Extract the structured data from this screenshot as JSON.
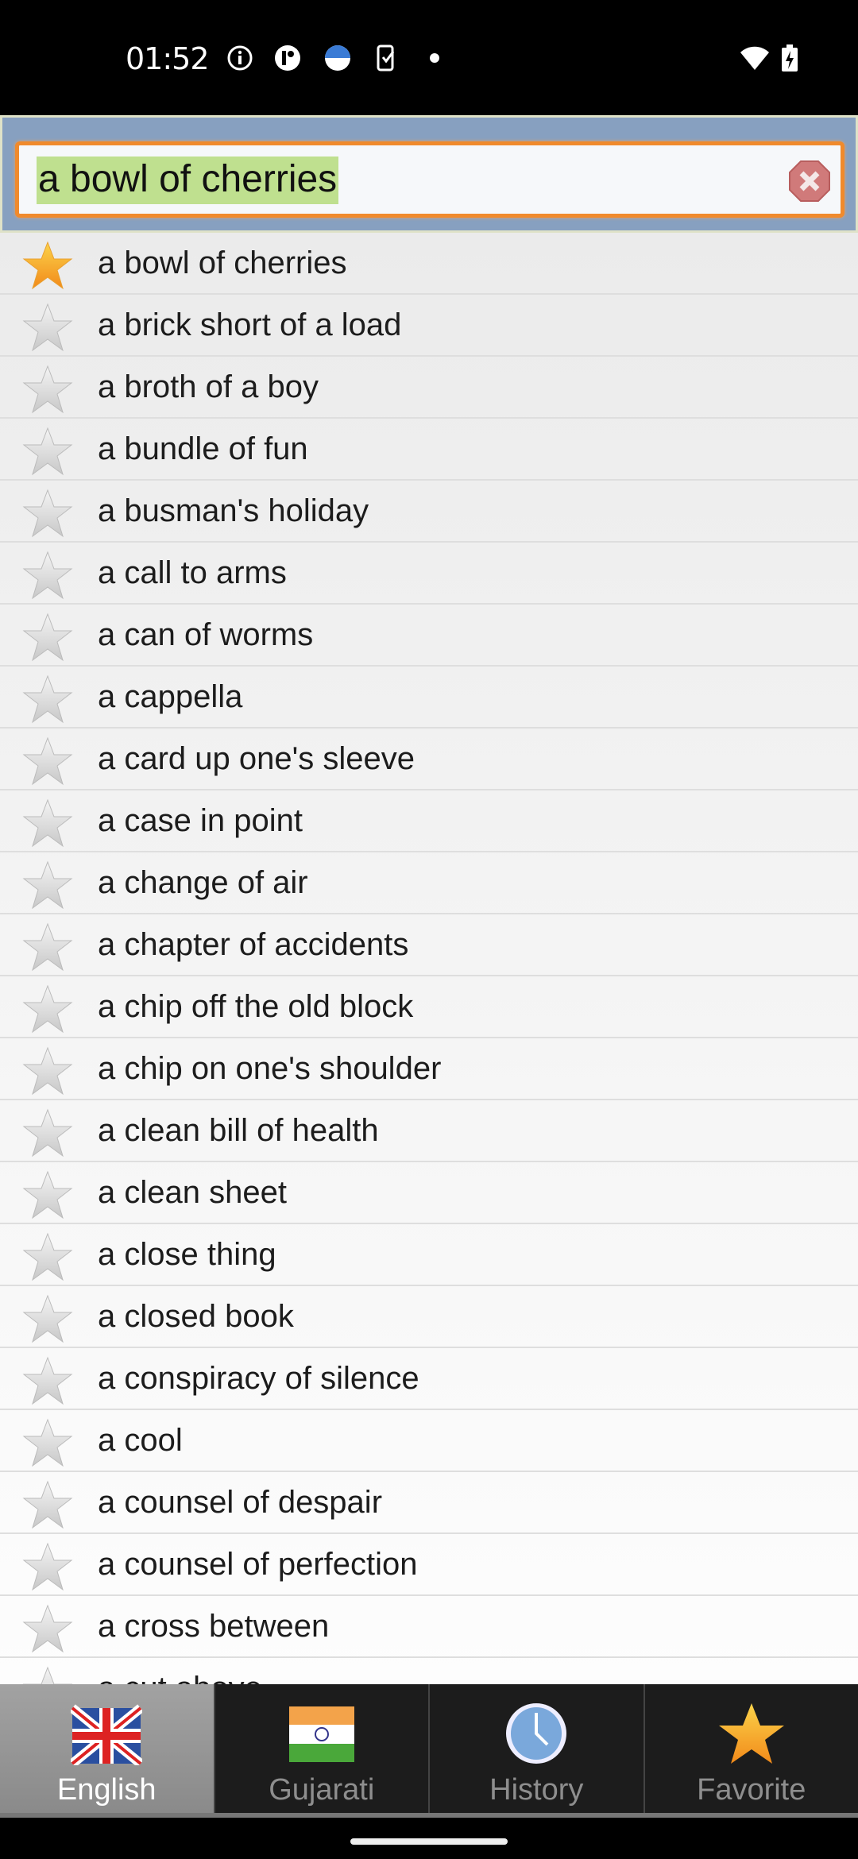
{
  "status_bar": {
    "time": "01:52",
    "icons": [
      "info-icon",
      "app-icon",
      "test-calendar-icon",
      "phone-check-icon",
      "dot-icon",
      "wifi-icon",
      "battery-charging-icon"
    ]
  },
  "search": {
    "value": "a bowl of cherries",
    "clear_icon": "clear-icon"
  },
  "list": {
    "items": [
      {
        "label": "a bowl of cherries",
        "favorite": true
      },
      {
        "label": "a brick short of a load",
        "favorite": false
      },
      {
        "label": "a broth of a boy",
        "favorite": false
      },
      {
        "label": "a bundle of fun",
        "favorite": false
      },
      {
        "label": "a busman's holiday",
        "favorite": false
      },
      {
        "label": "a call to arms",
        "favorite": false
      },
      {
        "label": "a can of worms",
        "favorite": false
      },
      {
        "label": "a cappella",
        "favorite": false
      },
      {
        "label": "a card up one's sleeve",
        "favorite": false
      },
      {
        "label": "a case in point",
        "favorite": false
      },
      {
        "label": "a change of air",
        "favorite": false
      },
      {
        "label": "a chapter of accidents",
        "favorite": false
      },
      {
        "label": "a chip off the old block",
        "favorite": false
      },
      {
        "label": "a chip on one's shoulder",
        "favorite": false
      },
      {
        "label": "a clean bill of health",
        "favorite": false
      },
      {
        "label": "a clean sheet",
        "favorite": false
      },
      {
        "label": "a close thing",
        "favorite": false
      },
      {
        "label": "a closed book",
        "favorite": false
      },
      {
        "label": "a conspiracy of silence",
        "favorite": false
      },
      {
        "label": "a cool",
        "favorite": false
      },
      {
        "label": "a counsel of despair",
        "favorite": false
      },
      {
        "label": "a counsel of perfection",
        "favorite": false
      },
      {
        "label": "a cross between",
        "favorite": false
      },
      {
        "label": "a cut above",
        "favorite": false
      }
    ]
  },
  "nav": {
    "tabs": [
      {
        "label": "English",
        "icon": "uk-flag-icon",
        "active": true
      },
      {
        "label": "Gujarati",
        "icon": "india-flag-icon",
        "active": false
      },
      {
        "label": "History",
        "icon": "clock-icon",
        "active": false
      },
      {
        "label": "Favorite",
        "icon": "star-icon",
        "active": false
      }
    ]
  },
  "colors": {
    "header": "#87a0c0",
    "search_border": "#f08a2c",
    "selection": "#bfe08f",
    "star_gold": "#f5a623"
  }
}
